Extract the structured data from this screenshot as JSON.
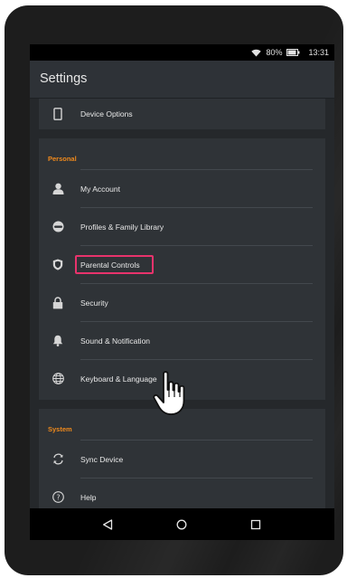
{
  "status": {
    "battery": "80%",
    "time": "13:31"
  },
  "header": {
    "title": "Settings"
  },
  "top_items": [
    {
      "label": "Device Options",
      "icon": "phone-icon"
    }
  ],
  "personal": {
    "title": "Personal",
    "items": [
      {
        "label": "My Account",
        "icon": "person-icon"
      },
      {
        "label": "Profiles & Family Library",
        "icon": "profile-face-icon"
      },
      {
        "label": "Parental Controls",
        "icon": "shield-icon"
      },
      {
        "label": "Security",
        "icon": "lock-icon"
      },
      {
        "label": "Sound & Notification",
        "icon": "bell-icon"
      },
      {
        "label": "Keyboard & Language",
        "icon": "globe-icon"
      }
    ]
  },
  "system": {
    "title": "System",
    "items": [
      {
        "label": "Sync Device",
        "icon": "sync-icon"
      },
      {
        "label": "Help",
        "icon": "help-icon"
      }
    ]
  },
  "nav": {
    "back": "back-icon",
    "home": "home-icon",
    "recents": "recents-icon"
  },
  "colors": {
    "accent": "#f08a1c",
    "highlight": "#e8336c",
    "card": "#2f3337"
  }
}
